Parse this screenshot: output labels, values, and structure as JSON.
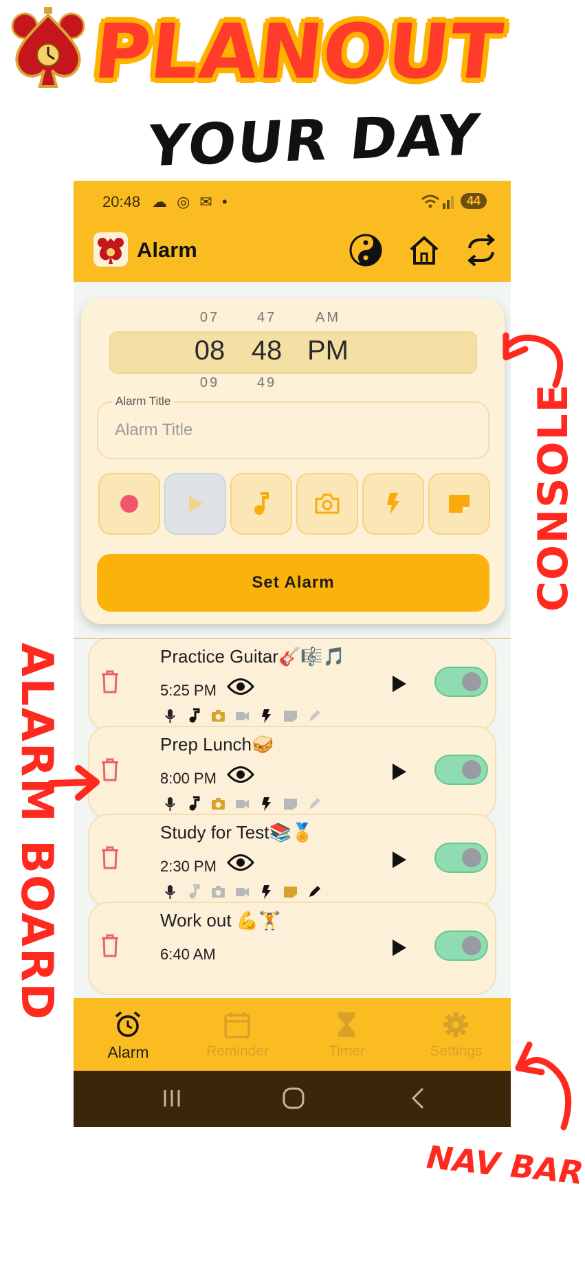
{
  "promo": {
    "headline": "PLANOUT",
    "subline": "YOUR DAY"
  },
  "status_bar": {
    "time": "20:48",
    "icons": "☁ ◎ ✉ •",
    "signal": "📶",
    "battery": "44"
  },
  "app_bar": {
    "title": "Alarm",
    "actions": [
      "yin-yang-icon",
      "home-icon",
      "sync-icon"
    ]
  },
  "console": {
    "picker": {
      "hours": [
        "07",
        "08",
        "09"
      ],
      "minutes": [
        "47",
        "48",
        "49"
      ],
      "periods": [
        "AM",
        "PM"
      ]
    },
    "title_field": {
      "label": "Alarm Title",
      "placeholder": "Alarm Title",
      "value": ""
    },
    "media_buttons": [
      "record-icon",
      "play-icon",
      "music-note-icon",
      "camera-icon",
      "flash-icon",
      "note-icon"
    ],
    "set_button": "Set Alarm"
  },
  "alarms": [
    {
      "name": "Practice Guitar🎸🎼🎵",
      "time": "5:25 PM",
      "enabled": true
    },
    {
      "name": "Prep Lunch🥪",
      "time": "8:00 PM",
      "enabled": true
    },
    {
      "name": "Study for Test📚🏅",
      "time": "2:30 PM",
      "enabled": true
    },
    {
      "name": "Work out 💪🏋",
      "time": "6:40 AM",
      "enabled": true
    }
  ],
  "bottom_nav": {
    "items": [
      {
        "label": "Alarm",
        "active": true
      },
      {
        "label": "Reminder",
        "active": false
      },
      {
        "label": "Timer",
        "active": false
      },
      {
        "label": "Settings",
        "active": false
      }
    ]
  },
  "annotations": {
    "console": "CONSOLE",
    "alarm_board": "ALARM BOARD",
    "nav_bar": "NAV BAR"
  },
  "colors": {
    "accent": "#fbbc22",
    "button": "#fbb20b",
    "card": "#fdf0d8",
    "annotation": "#ff2a1f",
    "toggle_on": "#8fdcb0",
    "delete": "#e8616e"
  }
}
